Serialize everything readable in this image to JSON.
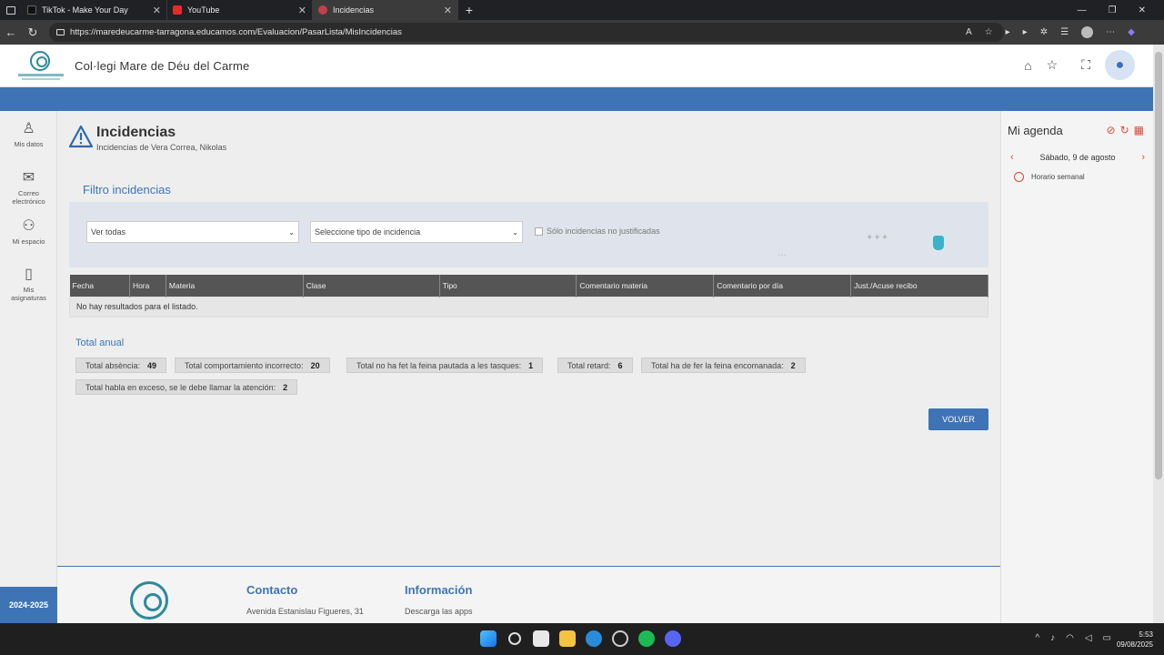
{
  "browser": {
    "tabs": [
      {
        "title": "TikTok - Make Your Day",
        "color": "#111111"
      },
      {
        "title": "YouTube",
        "color": "#e32b2b"
      },
      {
        "title": "Incidencias",
        "color": "#c2414b"
      }
    ],
    "url": "https://maredeucarme-tarragona.educamos.com/Evaluacion/PasarLista/MisIncidencias"
  },
  "header": {
    "school_name": "Col·legi Mare de Déu del Carme"
  },
  "sidebar": {
    "items": [
      {
        "label": "Mis datos",
        "icon": "person-icon"
      },
      {
        "label": "Correo electrónico",
        "icon": "mail-icon"
      },
      {
        "label": "Mi espacio",
        "icon": "network-icon"
      },
      {
        "label": "Mis asignaturas",
        "icon": "book-icon"
      }
    ],
    "year": "2024-2025"
  },
  "main": {
    "title": "Incidencias",
    "subtitle": "Incidencias de Vera Correa, Nikolas",
    "filter_title": "Filtro incidencias",
    "filter_all": "Ver todas",
    "filter_type": "Seleccione tipo de incidencia",
    "checkbox_label": "Sólo incidencias no justificadas",
    "table": {
      "columns": [
        "Fecha",
        "Hora",
        "Materia",
        "Clase",
        "Tipo",
        "Comentario materia",
        "Comentario por día",
        "Just./Acuse recibo"
      ],
      "empty_message": "No hay resultados para el listado."
    },
    "totals_title": "Total anual",
    "totals": [
      {
        "label": "Total absència:",
        "value": "49"
      },
      {
        "label": "Total comportamiento incorrecto:",
        "value": "20"
      },
      {
        "label": "Total no ha fet la feina pautada a les tasques:",
        "value": "1"
      },
      {
        "label": "Total retard:",
        "value": "6"
      },
      {
        "label": "Total ha de fer la feina encomanada:",
        "value": "2"
      },
      {
        "label": "Total habla en exceso, se le debe llamar la atención:",
        "value": "2"
      }
    ],
    "back_button": "VOLVER"
  },
  "footer": {
    "contact_title": "Contacto",
    "contact_text": "Avenida Estanislau Figueres, 31",
    "info_title": "Información",
    "info_text": "Descarga las apps"
  },
  "agenda": {
    "title": "Mi agenda",
    "date": "Sábado, 9 de agosto",
    "item": "Horario semanal"
  },
  "taskbar": {
    "time": "5:53",
    "date": "09/08/2025"
  },
  "colors": {
    "accent": "#3e74b5",
    "agenda_accent": "#d94b3a",
    "brand_teal": "#2b8a9e"
  }
}
